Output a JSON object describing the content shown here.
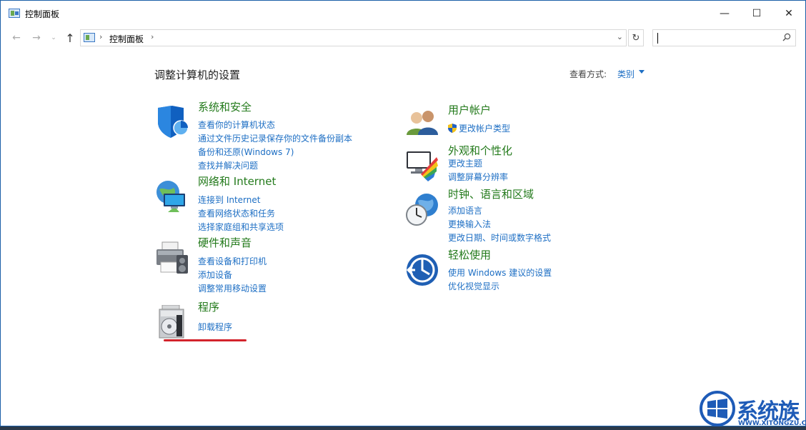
{
  "window": {
    "title": "控制面板",
    "minimize": "—",
    "maximize": "☐",
    "close": "✕"
  },
  "nav": {
    "back": "←",
    "forward": "→",
    "dropdown": "⌄",
    "up": "↑",
    "breadcrumb": "控制面板",
    "separator": "›",
    "chevron": "⌄",
    "refresh": "↻"
  },
  "search": {
    "placeholder": ""
  },
  "content": {
    "heading": "调整计算机的设置",
    "view_by_label": "查看方式:",
    "view_by_value": "类别"
  },
  "categories": [
    {
      "title": "系统和安全",
      "links": [
        "查看你的计算机状态",
        "通过文件历史记录保存你的文件备份副本",
        "备份和还原(Windows 7)",
        "查找并解决问题"
      ]
    },
    {
      "title": "网络和 Internet",
      "links": [
        "连接到 Internet",
        "查看网络状态和任务",
        "选择家庭组和共享选项"
      ]
    },
    {
      "title": "硬件和声音",
      "links": [
        "查看设备和打印机",
        "添加设备",
        "调整常用移动设置"
      ]
    },
    {
      "title": "程序",
      "links": [
        "卸载程序"
      ]
    },
    {
      "title": "用户帐户",
      "links": [
        "更改帐户类型"
      ]
    },
    {
      "title": "外观和个性化",
      "links": [
        "更改主题",
        "调整屏幕分辨率"
      ]
    },
    {
      "title": "时钟、语言和区域",
      "links": [
        "添加语言",
        "更换输入法",
        "更改日期、时间或数字格式"
      ]
    },
    {
      "title": "轻松使用",
      "links": [
        "使用 Windows 建议的设置",
        "优化视觉显示"
      ]
    }
  ],
  "watermark": {
    "text": "系统族",
    "sub": "WWW.XITONGZU.COM"
  },
  "colors": {
    "link": "#1e6fc4",
    "category_title": "#237a1b",
    "highlight": "#d3242c"
  }
}
